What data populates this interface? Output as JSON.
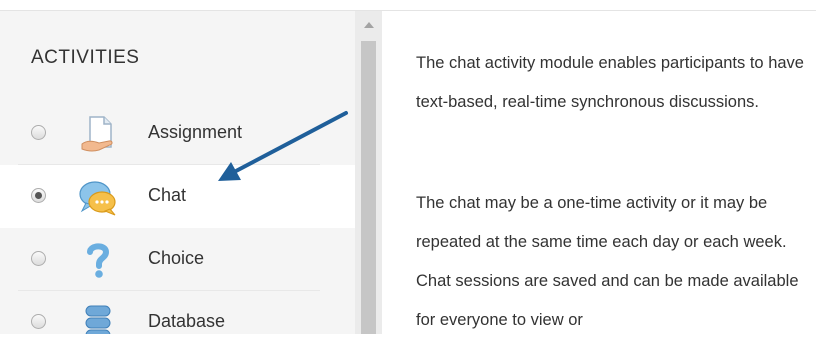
{
  "activities": {
    "heading": "ACTIVITIES",
    "items": [
      {
        "label": "Assignment",
        "icon": "assignment-icon",
        "selected": false
      },
      {
        "label": "Chat",
        "icon": "chat-icon",
        "selected": true
      },
      {
        "label": "Choice",
        "icon": "choice-icon",
        "selected": false
      },
      {
        "label": "Database",
        "icon": "database-icon",
        "selected": false
      }
    ]
  },
  "description": {
    "paragraphs": [
      "The chat activity module enables participants to have text-based, real-time synchronous discussions.",
      "The chat may be a one-time activity or it may be repeated at the same time each day or each week. Chat sessions are saved and can be made available for everyone to view or"
    ]
  },
  "colors": {
    "panel_bg": "#f5f5f5",
    "selected_bg": "#ffffff",
    "arrow": "#1f5f9a",
    "text": "#333333"
  }
}
